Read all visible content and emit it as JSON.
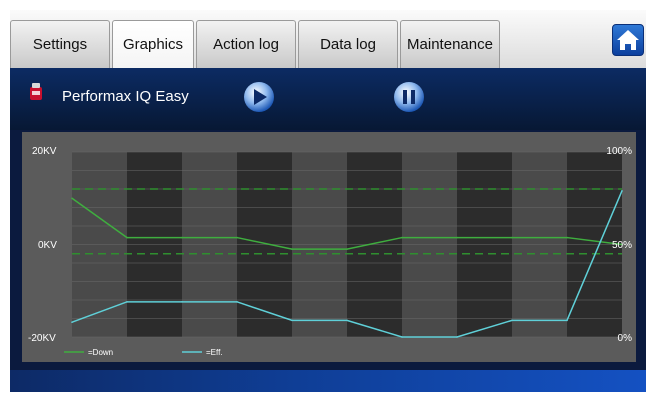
{
  "tabs": [
    {
      "label": "Settings",
      "active": false
    },
    {
      "label": "Graphics",
      "active": true
    },
    {
      "label": "Action log",
      "active": false
    },
    {
      "label": "Data log",
      "active": false
    },
    {
      "label": "Maintenance",
      "active": false
    }
  ],
  "home_icon": "home-icon",
  "product": {
    "name": "Performax IQ Easy",
    "icon": "ionizer-device-icon"
  },
  "controls": {
    "play_icon": "play-icon",
    "pause_icon": "pause-icon"
  },
  "colors": {
    "down": "#3fae3f",
    "eff": "#5fd0d8",
    "limit": "#2f8f2f",
    "panel": "#5b5b5b"
  },
  "chart_data": {
    "type": "line",
    "left_axis": {
      "labels": [
        "20KV",
        "0KV",
        "-20KV"
      ],
      "ylim": [
        -20,
        20
      ]
    },
    "right_axis": {
      "labels": [
        "100%",
        "50%",
        "0%"
      ],
      "ylim": [
        0,
        100
      ]
    },
    "limit_lines_kv": [
      12,
      -2
    ],
    "series": [
      {
        "name": "=Down",
        "axis": "left",
        "unit": "kV",
        "x": [
          0,
          1,
          2,
          3,
          4,
          5,
          6,
          7,
          8,
          9,
          10
        ],
        "values": [
          10,
          1.5,
          1.5,
          1.5,
          -1,
          -1,
          1.5,
          1.5,
          1.5,
          1.5,
          0
        ]
      },
      {
        "name": "=Eff.",
        "axis": "right",
        "unit": "%",
        "x": [
          0,
          1,
          2,
          3,
          4,
          5,
          6,
          7,
          8,
          9,
          10
        ],
        "values": [
          8,
          19,
          19,
          19,
          9,
          9,
          0,
          0,
          9,
          9,
          79
        ]
      }
    ],
    "grid": true,
    "legend": "bottom-left"
  }
}
